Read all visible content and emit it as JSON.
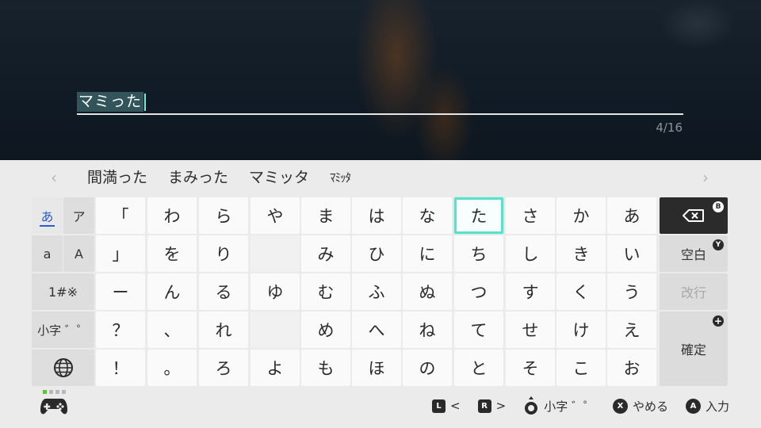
{
  "input": {
    "text": "マミった",
    "counter": "4/16"
  },
  "suggestions": {
    "prev_arrow": "‹",
    "next_arrow": "›",
    "items": [
      "間満った",
      "まみった",
      "マミッタ",
      "ﾏﾐｯﾀ"
    ]
  },
  "mode_keys": {
    "hiragana": "あ",
    "katakana": "ア",
    "lower_latin": "a",
    "upper_latin": "A",
    "symbols": "1#※",
    "small_char": "小字 ゛゜",
    "globe_icon": "globe-icon"
  },
  "grid": [
    [
      "「",
      "わ",
      "ら",
      "や",
      "ま",
      "は",
      "な",
      "た",
      "さ",
      "か",
      "あ"
    ],
    [
      "」",
      "を",
      "り",
      "",
      "み",
      "ひ",
      "に",
      "ち",
      "し",
      "き",
      "い"
    ],
    [
      "ー",
      "ん",
      "る",
      "ゆ",
      "む",
      "ふ",
      "ぬ",
      "つ",
      "す",
      "く",
      "う"
    ],
    [
      "？",
      "、",
      "れ",
      "",
      "め",
      "へ",
      "ね",
      "て",
      "せ",
      "け",
      "え"
    ],
    [
      "！",
      "。",
      "ろ",
      "よ",
      "も",
      "ほ",
      "の",
      "と",
      "そ",
      "こ",
      "お"
    ]
  ],
  "side_keys": {
    "backspace_badge": "B",
    "space_label": "空白",
    "space_badge": "Y",
    "newline_label": "改行",
    "confirm_label": "確定",
    "confirm_badge": "+"
  },
  "footer": {
    "hint_prev_badge": "L",
    "hint_prev_label": "<",
    "hint_next_badge": "R",
    "hint_next_label": ">",
    "hint_small_label": "小字 ゛゜",
    "hint_cancel_badge": "X",
    "hint_cancel_label": "やめる",
    "hint_input_badge": "A",
    "hint_input_label": "入力"
  },
  "colors": {
    "accent_teal": "#5ee0c8",
    "selection_highlight": "#32545a",
    "mode_underline": "#2e5cc8",
    "controller_indicator": "#5fc33c"
  }
}
